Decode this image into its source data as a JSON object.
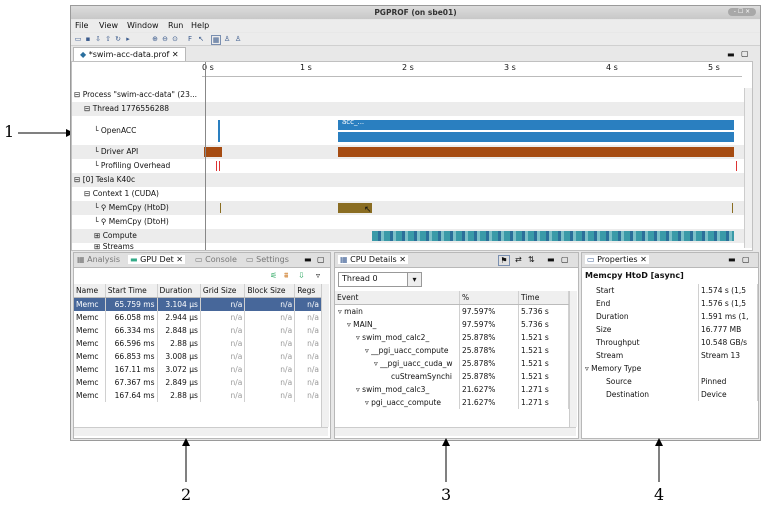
{
  "window": {
    "title": "PGPROF (on sbe01)",
    "controls": "- ☐ ×"
  },
  "menu": [
    "File",
    "View",
    "Window",
    "Run",
    "Help"
  ],
  "editor_tab": "*swim-acc-data.prof",
  "ruler_ticks": [
    "0 s",
    "1 s",
    "2 s",
    "3 s",
    "4 s",
    "5 s"
  ],
  "timeline_rows": [
    {
      "label": "Process \"swim-acc-data\" (23...",
      "prefix": "⊟"
    },
    {
      "label": "Thread 1776556288",
      "prefix": "⊟"
    },
    {
      "label": "OpenACC",
      "prefix": "└"
    },
    {
      "label": "Driver API",
      "prefix": "└"
    },
    {
      "label": "Profiling Overhead",
      "prefix": "└"
    },
    {
      "label": "[0] Tesla K40c",
      "prefix": "⊟"
    },
    {
      "label": "Context 1 (CUDA)",
      "prefix": "⊟"
    },
    {
      "label": "MemCpy (HtoD)",
      "prefix": "└ ⚲"
    },
    {
      "label": "MemCpy (DtoH)",
      "prefix": "└ ⚲"
    },
    {
      "label": "Compute",
      "prefix": "⊞"
    },
    {
      "label": "Streams",
      "prefix": "⊞"
    }
  ],
  "timeline_openacc_label": "acc_...",
  "colors": {
    "openacc": "#2a7fc0",
    "driver": "#a64c12",
    "memcpy": "#8a6d22",
    "compute": "#3a9aa8",
    "selection": "#47679a"
  },
  "panel2": {
    "tabs": [
      "Analysis",
      "GPU Det",
      "Console",
      "Settings"
    ],
    "columns": [
      "Name",
      "Start Time",
      "Duration",
      "Grid Size",
      "Block Size",
      "Regs"
    ],
    "rows": [
      [
        "Memc",
        "65.759 ms",
        "3.104 µs",
        "n/a",
        "n/a",
        "n/a"
      ],
      [
        "Memc",
        "66.058 ms",
        "2.944 µs",
        "n/a",
        "n/a",
        "n/a"
      ],
      [
        "Memc",
        "66.334 ms",
        "2.848 µs",
        "n/a",
        "n/a",
        "n/a"
      ],
      [
        "Memc",
        "66.596 ms",
        "2.88 µs",
        "n/a",
        "n/a",
        "n/a"
      ],
      [
        "Memc",
        "66.853 ms",
        "3.008 µs",
        "n/a",
        "n/a",
        "n/a"
      ],
      [
        "Memc",
        "167.11 ms",
        "3.072 µs",
        "n/a",
        "n/a",
        "n/a"
      ],
      [
        "Memc",
        "67.367 ms",
        "2.849 µs",
        "n/a",
        "n/a",
        "n/a"
      ],
      [
        "Memc",
        "167.64 ms",
        "2.88 µs",
        "n/a",
        "n/a",
        "n/a"
      ]
    ]
  },
  "panel3": {
    "tab": "CPU Details",
    "thread_select": "Thread 0",
    "columns": [
      "Event",
      "%",
      "Time"
    ],
    "rows": [
      {
        "event": "main",
        "pct": "97.597%",
        "time": "5.736 s",
        "indent": 0,
        "arrow": "▿"
      },
      {
        "event": "MAIN_",
        "pct": "97.597%",
        "time": "5.736 s",
        "indent": 1,
        "arrow": "▿"
      },
      {
        "event": "swim_mod_calc2_",
        "pct": "25.878%",
        "time": "1.521 s",
        "indent": 2,
        "arrow": "▿"
      },
      {
        "event": "__pgi_uacc_compute",
        "pct": "25.878%",
        "time": "1.521 s",
        "indent": 3,
        "arrow": "▿"
      },
      {
        "event": "__pgi_uacc_cuda_w",
        "pct": "25.878%",
        "time": "1.521 s",
        "indent": 4,
        "arrow": "▿"
      },
      {
        "event": "cuStreamSynchi",
        "pct": "25.878%",
        "time": "1.521 s",
        "indent": 5,
        "arrow": ""
      },
      {
        "event": "swim_mod_calc3_",
        "pct": "21.627%",
        "time": "1.271 s",
        "indent": 2,
        "arrow": "▿"
      },
      {
        "event": "pgi_uacc_compute",
        "pct": "21.627%",
        "time": "1.271 s",
        "indent": 3,
        "arrow": "▿"
      }
    ]
  },
  "panel4": {
    "tab": "Properties",
    "heading": "Memcpy HtoD [async]",
    "rows": [
      {
        "key": "Start",
        "value": "1.574 s (1,5",
        "indent": 1
      },
      {
        "key": "End",
        "value": "1.576 s (1,5",
        "indent": 1
      },
      {
        "key": "Duration",
        "value": "1.591 ms (1,",
        "indent": 1
      },
      {
        "key": "Size",
        "value": "16.777 MB",
        "indent": 1
      },
      {
        "key": "Throughput",
        "value": "10.548 GB/s",
        "indent": 1
      },
      {
        "key": "Stream",
        "value": "Stream 13",
        "indent": 1
      },
      {
        "key": "Memory Type",
        "value": "",
        "indent": 0
      },
      {
        "key": "Source",
        "value": "Pinned",
        "indent": 2
      },
      {
        "key": "Destination",
        "value": "Device",
        "indent": 2
      }
    ]
  },
  "callouts": [
    "1",
    "2",
    "3",
    "4"
  ]
}
